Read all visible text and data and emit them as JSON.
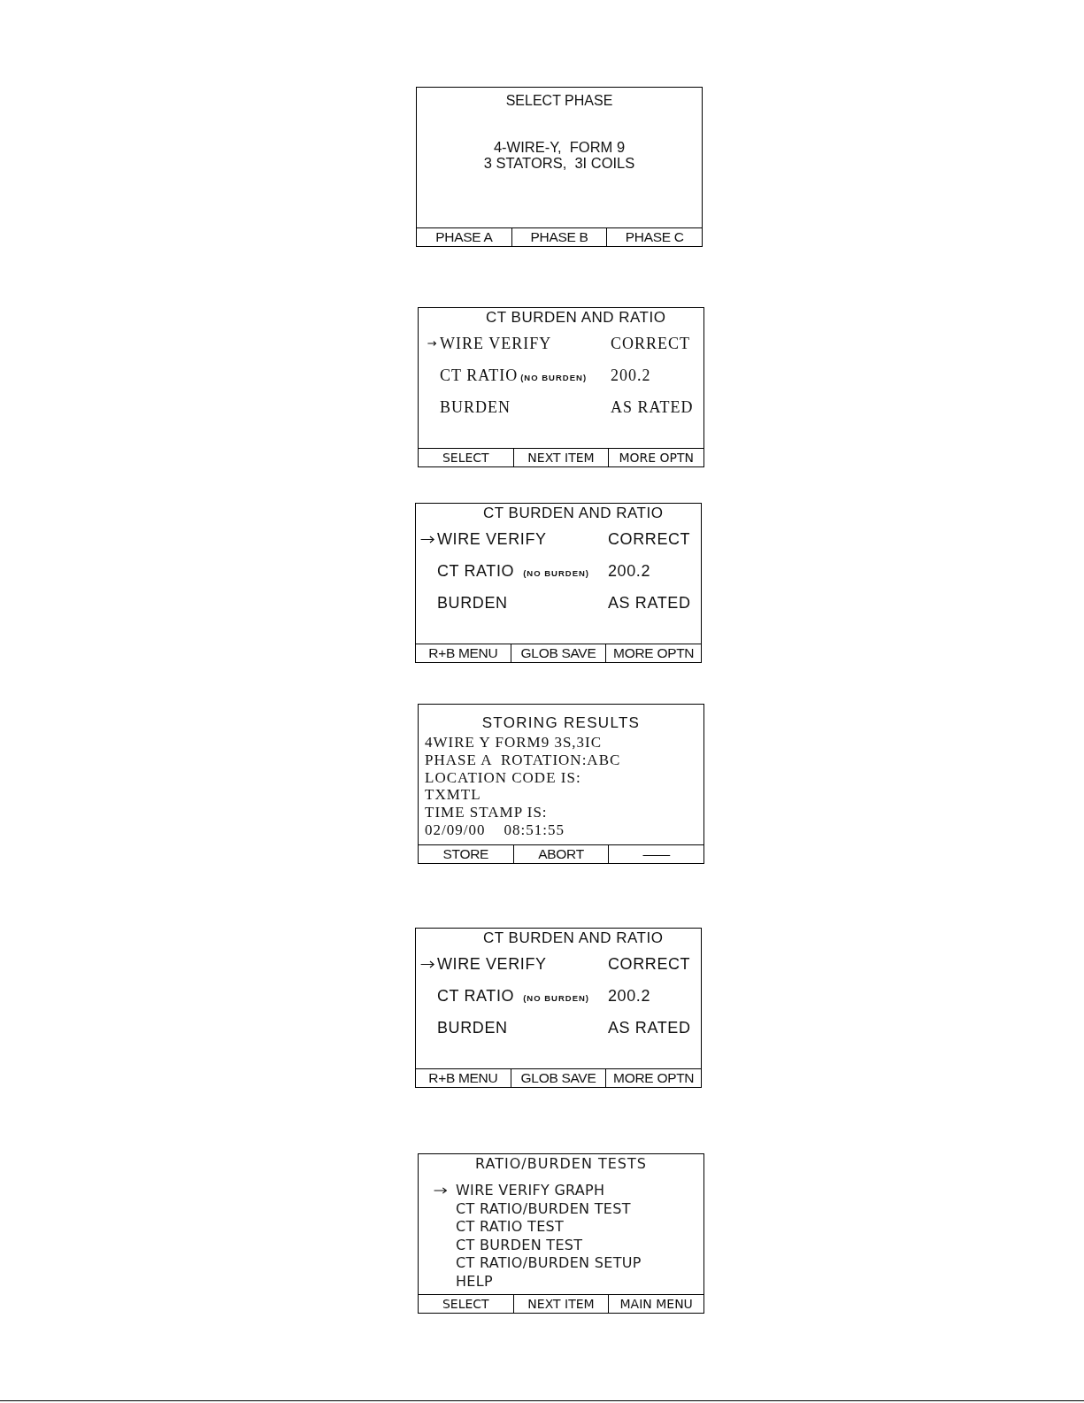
{
  "screens": [
    {
      "kind": "message",
      "title": "SELECT PHASE",
      "lines": [
        "4-WIRE-Y,  FORM 9",
        "3 STATORS,  3I COILS"
      ],
      "softkeys": [
        "PHASE A",
        "PHASE B",
        "PHASE C"
      ]
    },
    {
      "kind": "settings",
      "title": "CT BURDEN AND RATIO",
      "items": [
        {
          "label": "WIRE VERIFY",
          "value": "CORRECT",
          "selected": true
        },
        {
          "label": "CT RATIO",
          "note": "(NO BURDEN)",
          "value": "200.2",
          "selected": false
        },
        {
          "label": "BURDEN",
          "value": "AS RATED",
          "selected": false
        }
      ],
      "softkeys": [
        "SELECT",
        "NEXT ITEM",
        "MORE OPTN"
      ]
    },
    {
      "kind": "settings",
      "title": "CT BURDEN AND RATIO",
      "items": [
        {
          "label": "WIRE VERIFY",
          "value": "CORRECT",
          "selected": true
        },
        {
          "label": "CT RATIO",
          "note": "(NO BURDEN)",
          "value": "200.2",
          "selected": false
        },
        {
          "label": "BURDEN",
          "value": "AS RATED",
          "selected": false
        }
      ],
      "softkeys": [
        "R+B MENU",
        "GLOB SAVE",
        "MORE OPTN"
      ]
    },
    {
      "kind": "record",
      "title": "STORING RESULTS",
      "lines": [
        "4WIRE Y FORM9 3S,3IC",
        "PHASE A  ROTATION:ABC",
        "LOCATION CODE IS:",
        "TXMTL",
        "TIME STAMP IS:",
        "02/09/00    08:51:55"
      ],
      "softkeys": [
        "STORE",
        "ABORT",
        "——"
      ]
    },
    {
      "kind": "settings",
      "title": "CT BURDEN AND RATIO",
      "items": [
        {
          "label": "WIRE VERIFY",
          "value": "CORRECT",
          "selected": true
        },
        {
          "label": "CT RATIO",
          "note": "(NO BURDEN)",
          "value": "200.2",
          "selected": false
        },
        {
          "label": "BURDEN",
          "value": "AS RATED",
          "selected": false
        }
      ],
      "softkeys": [
        "R+B MENU",
        "GLOB SAVE",
        "MORE OPTN"
      ]
    },
    {
      "kind": "menu",
      "title": "RATIO/BURDEN TESTS",
      "items": [
        {
          "label": "WIRE VERIFY GRAPH",
          "selected": true
        },
        {
          "label": "CT RATIO/BURDEN TEST",
          "selected": false
        },
        {
          "label": "CT RATIO TEST",
          "selected": false
        },
        {
          "label": "CT BURDEN TEST",
          "selected": false
        },
        {
          "label": "CT RATIO/BURDEN SETUP",
          "selected": false
        },
        {
          "label": "HELP",
          "selected": false
        }
      ],
      "softkeys": [
        "SELECT",
        "NEXT ITEM",
        "MAIN MENU"
      ]
    }
  ]
}
